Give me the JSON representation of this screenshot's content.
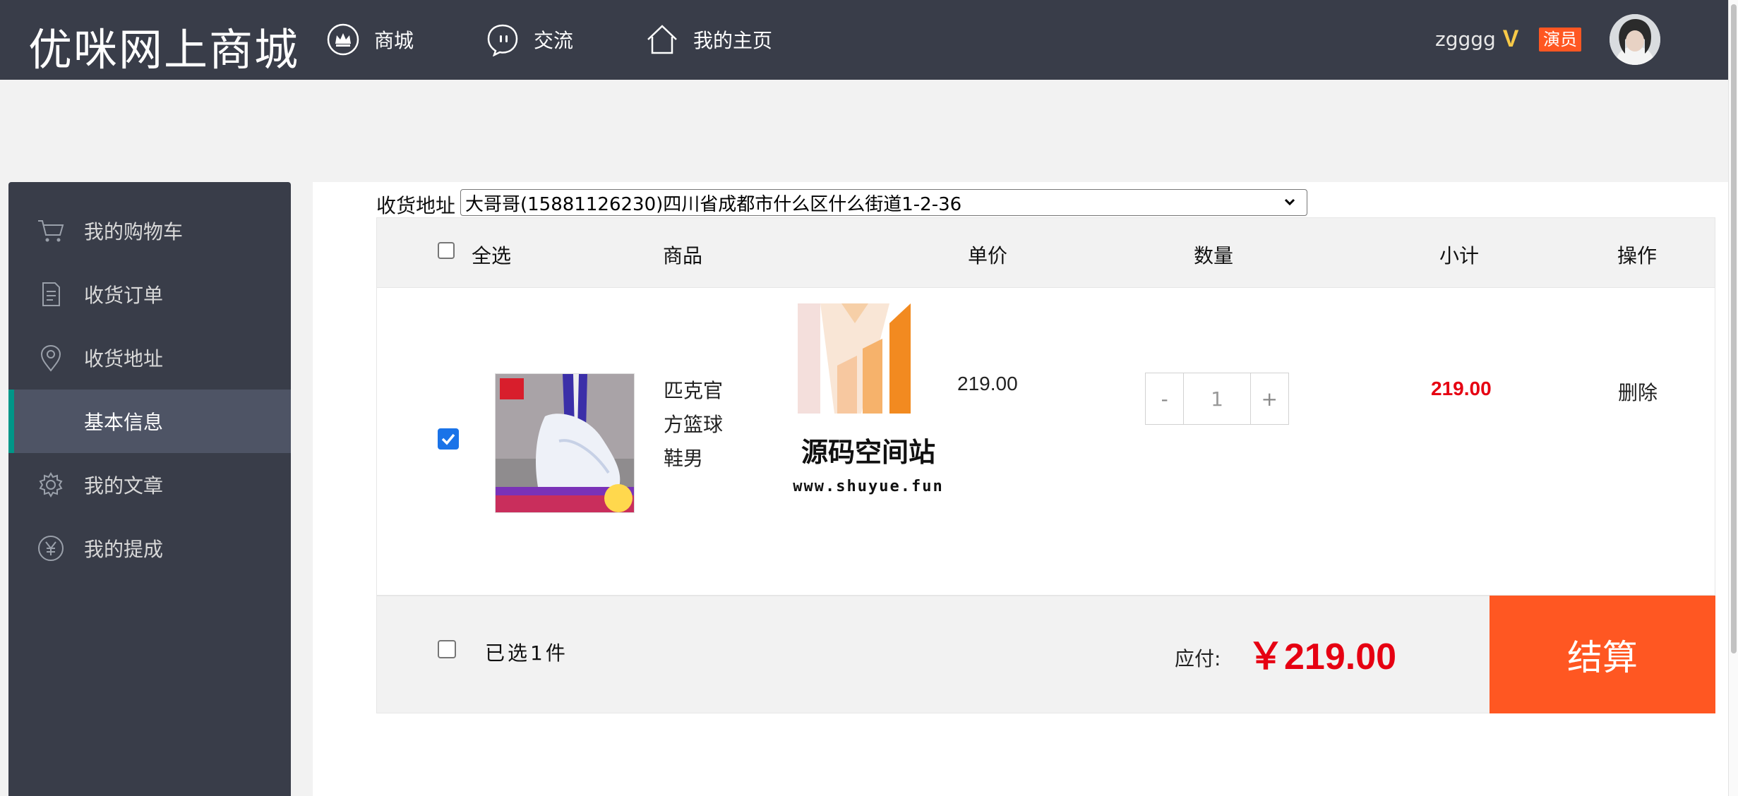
{
  "header": {
    "brand": "优咪网上商城",
    "nav": [
      {
        "label": "商城",
        "icon": "crown-icon"
      },
      {
        "label": "交流",
        "icon": "chat-icon"
      },
      {
        "label": "我的主页",
        "icon": "home-icon"
      }
    ],
    "user": {
      "name": "zgggg",
      "vip_badge": "V",
      "role_badge": "演员"
    }
  },
  "sidebar": {
    "items": [
      {
        "label": "我的购物车",
        "icon": "cart-icon"
      },
      {
        "label": "收货订单",
        "icon": "document-icon"
      },
      {
        "label": "收货地址",
        "icon": "location-pin-icon"
      },
      {
        "label": "基本信息",
        "icon": "",
        "active": true
      },
      {
        "label": "我的文章",
        "icon": "gear-icon"
      },
      {
        "label": "我的提成",
        "icon": "yen-icon"
      }
    ]
  },
  "address": {
    "label": "收货地址",
    "selected": "大哥哥(15881126230)四川省成都市什么区什么街道1-2-36"
  },
  "cart": {
    "columns": {
      "select_all": "全选",
      "product": "商品",
      "unit_price": "单价",
      "quantity": "数量",
      "subtotal": "小计",
      "action": "操作"
    },
    "items": [
      {
        "checked": true,
        "name": "匹克官方篮球鞋男",
        "unit_price": "219.00",
        "qty_minus": "-",
        "quantity": "1",
        "qty_plus": "+",
        "subtotal": "219.00",
        "action": "删除"
      }
    ],
    "watermark": {
      "title": "源码空间站",
      "url": "www.shuyue.fun"
    },
    "footer": {
      "select_all_checked": false,
      "selected_text": "已选1件",
      "pay_label": "应付:",
      "total": "￥219.00",
      "checkout_label": "结算"
    }
  },
  "colors": {
    "topbar": "#393d49",
    "sidebar": "#393d49",
    "sidebar_active": "#4e5465",
    "active_indicator": "#009688",
    "price_red": "#e60012",
    "checkout": "#ff5722",
    "role_badge": "#ff5722",
    "vip": "#f7c948"
  }
}
